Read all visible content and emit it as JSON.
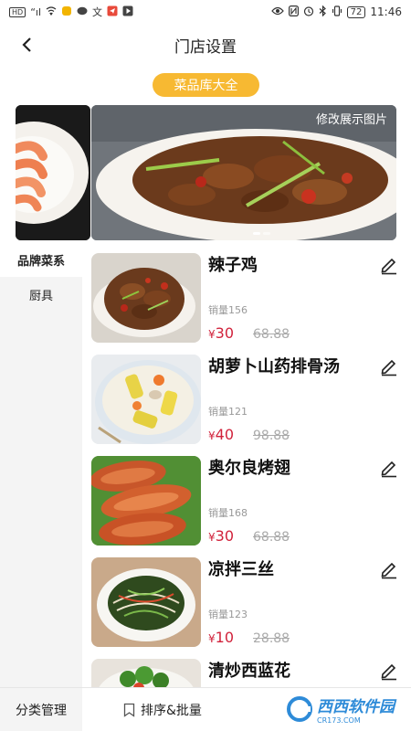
{
  "status_bar": {
    "left_icons": [
      "hd-icon",
      "signal-icon",
      "wifi-icon",
      "app-icon",
      "chat-icon",
      "translate-icon",
      "send-icon",
      "play-icon"
    ],
    "hd": "HD",
    "battery": "72",
    "time": "11:46"
  },
  "header": {
    "title": "门店设置"
  },
  "library_button": {
    "label": "菜品库大全"
  },
  "carousel": {
    "edit_photo_label": "修改展示图片"
  },
  "side_nav": {
    "items": [
      {
        "label": "品牌菜系"
      },
      {
        "label": "厨具"
      }
    ]
  },
  "dishes": [
    {
      "name": "辣子鸡",
      "sales": "销量156",
      "price": "30",
      "original_price": "68.88"
    },
    {
      "name": "胡萝卜山药排骨汤",
      "sales": "销量121",
      "price": "40",
      "original_price": "98.88"
    },
    {
      "name": "奥尔良烤翅",
      "sales": "销量168",
      "price": "30",
      "original_price": "68.88"
    },
    {
      "name": "凉拌三丝",
      "sales": "销量123",
      "price": "10",
      "original_price": "28.88"
    },
    {
      "name": "清炒西蓝花",
      "sales": "",
      "price": "",
      "original_price": ""
    }
  ],
  "currency_symbol": "¥",
  "bottom_bar": {
    "category_manage": "分类管理",
    "sort_batch": "排序&批量"
  },
  "watermark": {
    "text": "西西软件园",
    "sub": "CR173.COM"
  },
  "colors": {
    "accent": "#F7B932",
    "price": "#D1223B",
    "side_bg": "#F4F4F4"
  }
}
